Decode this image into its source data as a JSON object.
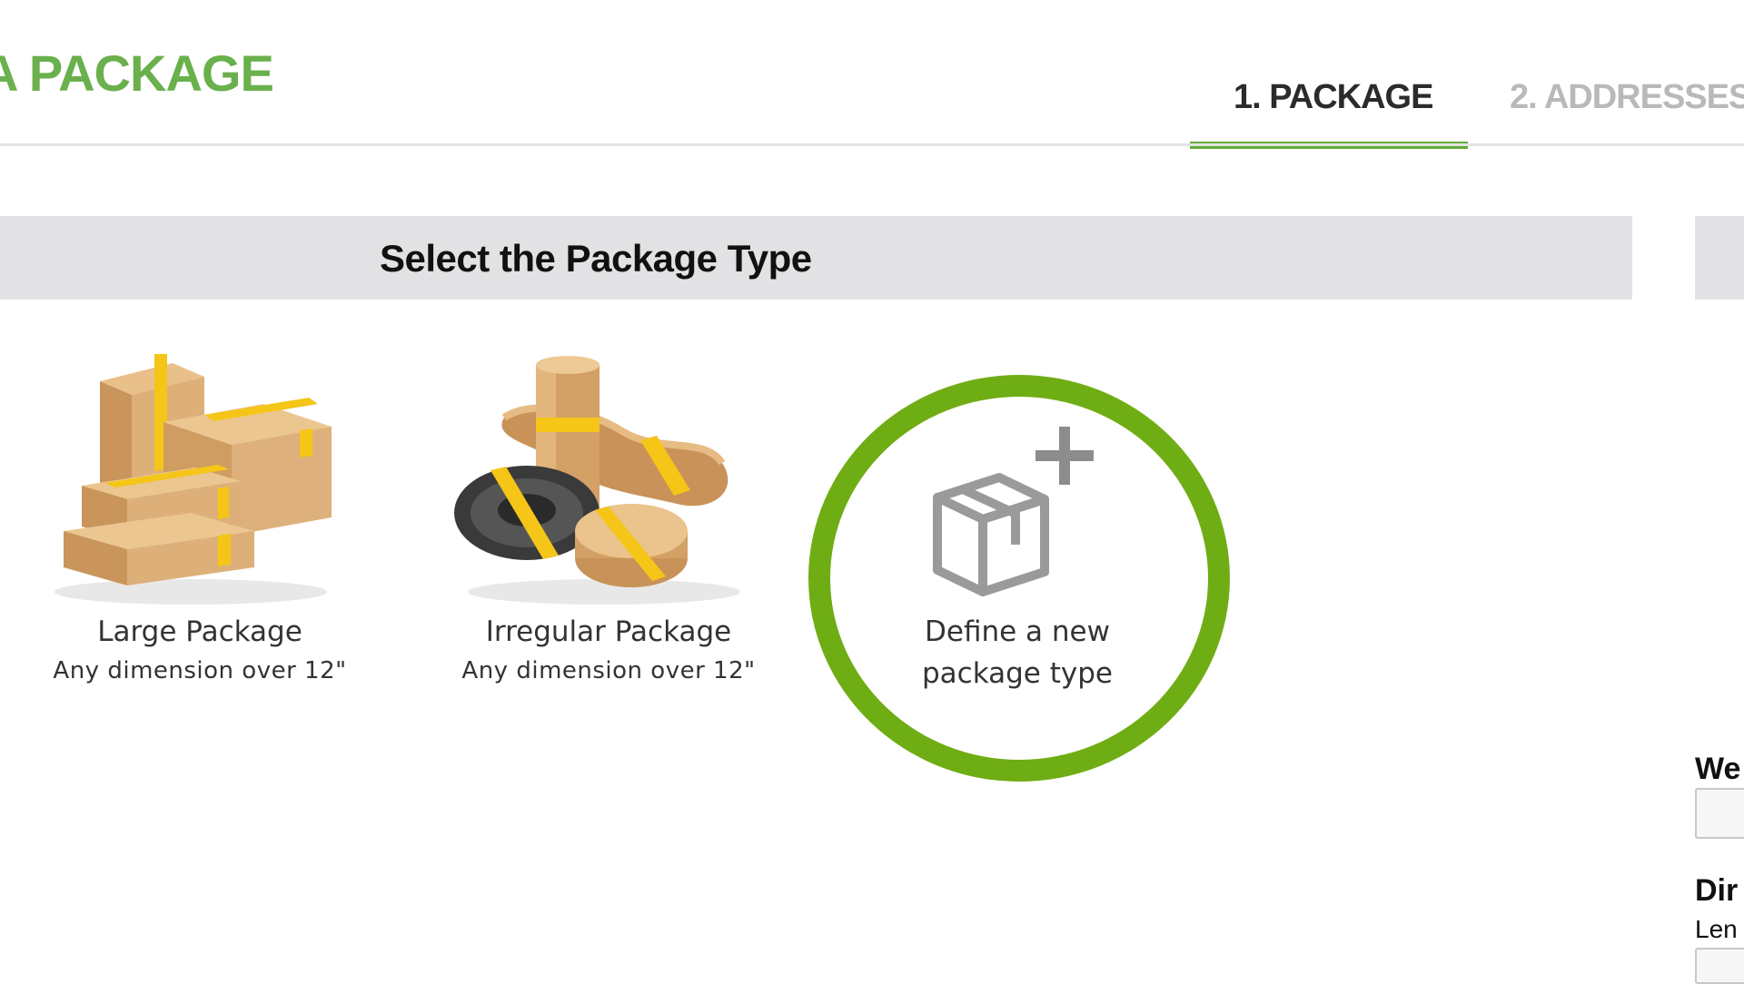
{
  "header": {
    "title": "A PACKAGE"
  },
  "steps": [
    {
      "label": "1. PACKAGE",
      "active": true
    },
    {
      "label": "2. ADDRESSES",
      "active": false
    }
  ],
  "section": {
    "title": "Select the Package Type"
  },
  "package_options": [
    {
      "label": "Large Package",
      "sub": "Any dimension over 12\"",
      "icon": "large-package-icon"
    },
    {
      "label": "Irregular Package",
      "sub": "Any dimension over 12\"",
      "icon": "irregular-package-icon"
    },
    {
      "label_line1": "Define a new",
      "label_line2": "package type",
      "icon": "add-package-icon"
    }
  ],
  "right_panel": {
    "weight_label": "We",
    "dimensions_label": "Dir",
    "length_label": "Len"
  },
  "colors": {
    "brand_green": "#6ab04c",
    "tab_underline": "#62ab3a",
    "highlight_ring": "#6fad14",
    "section_bar": "#e2e2e4",
    "cardboard": "#d7a86e",
    "tape": "#f5c518"
  }
}
